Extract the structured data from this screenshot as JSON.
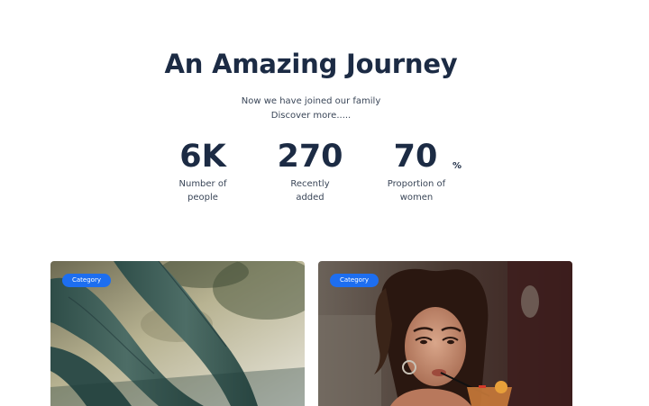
{
  "hero": {
    "title": "An Amazing Journey",
    "subtitle_line1": "Now we have joined our family",
    "subtitle_line2": "Discover more....."
  },
  "stats": [
    {
      "value": "6K",
      "label_line1": "Number of",
      "label_line2": "people"
    },
    {
      "value": "270",
      "label_line1": "Recently",
      "label_line2": "added"
    },
    {
      "value": "70",
      "unit": "%",
      "label_line1": "Proportion of",
      "label_line2": "women"
    }
  ],
  "cards": [
    {
      "badge": "Category",
      "image": "green-leggings-photo"
    },
    {
      "badge": "Category",
      "image": "woman-drinking-cocktail-photo"
    }
  ],
  "colors": {
    "heading": "#1c2b44",
    "body_text": "#3a4658",
    "badge_bg": "#1d6ef0",
    "badge_text": "#ffffff",
    "background": "#ffffff"
  }
}
